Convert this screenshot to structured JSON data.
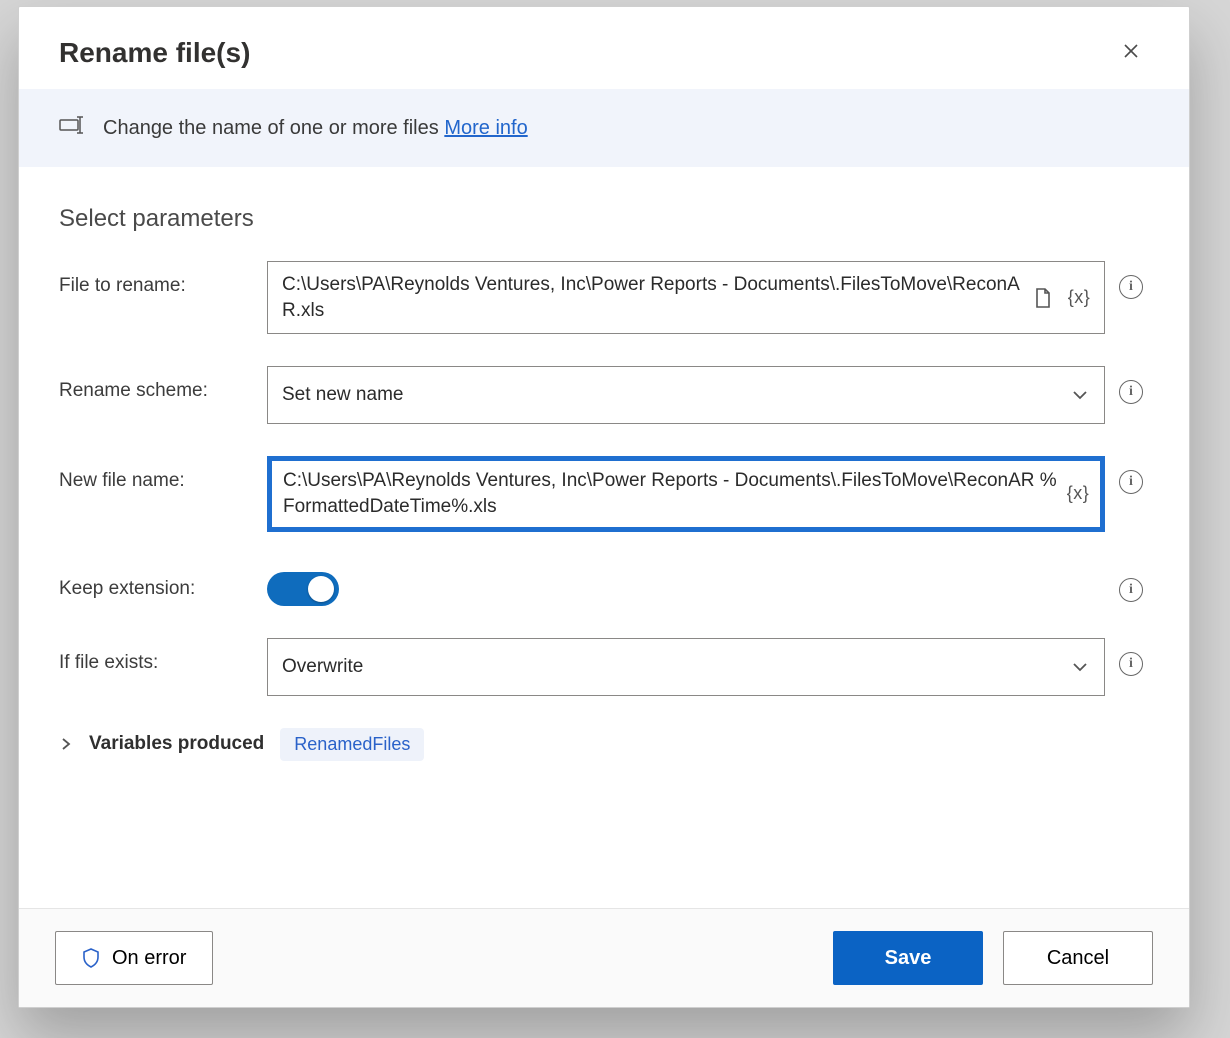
{
  "dialog": {
    "title": "Rename file(s)",
    "banner_text": "Change the name of one or more files",
    "banner_link": "More info",
    "section_title": "Select parameters"
  },
  "fields": {
    "file_to_rename": {
      "label": "File to rename:",
      "value": "C:\\Users\\PA\\Reynolds Ventures, Inc\\Power Reports - Documents\\.FilesToMove\\ReconAR.xls"
    },
    "rename_scheme": {
      "label": "Rename scheme:",
      "value": "Set new name"
    },
    "new_file_name": {
      "label": "New file name:",
      "value": "C:\\Users\\PA\\Reynolds Ventures, Inc\\Power Reports - Documents\\.FilesToMove\\ReconAR %FormattedDateTime%.xls"
    },
    "keep_extension": {
      "label": "Keep extension:",
      "value": true
    },
    "if_file_exists": {
      "label": "If file exists:",
      "value": "Overwrite"
    }
  },
  "variables_produced": {
    "label": "Variables produced",
    "chip": "RenamedFiles"
  },
  "footer": {
    "on_error": "On error",
    "save": "Save",
    "cancel": "Cancel"
  },
  "tokens": {
    "var_braces": "{x}"
  }
}
